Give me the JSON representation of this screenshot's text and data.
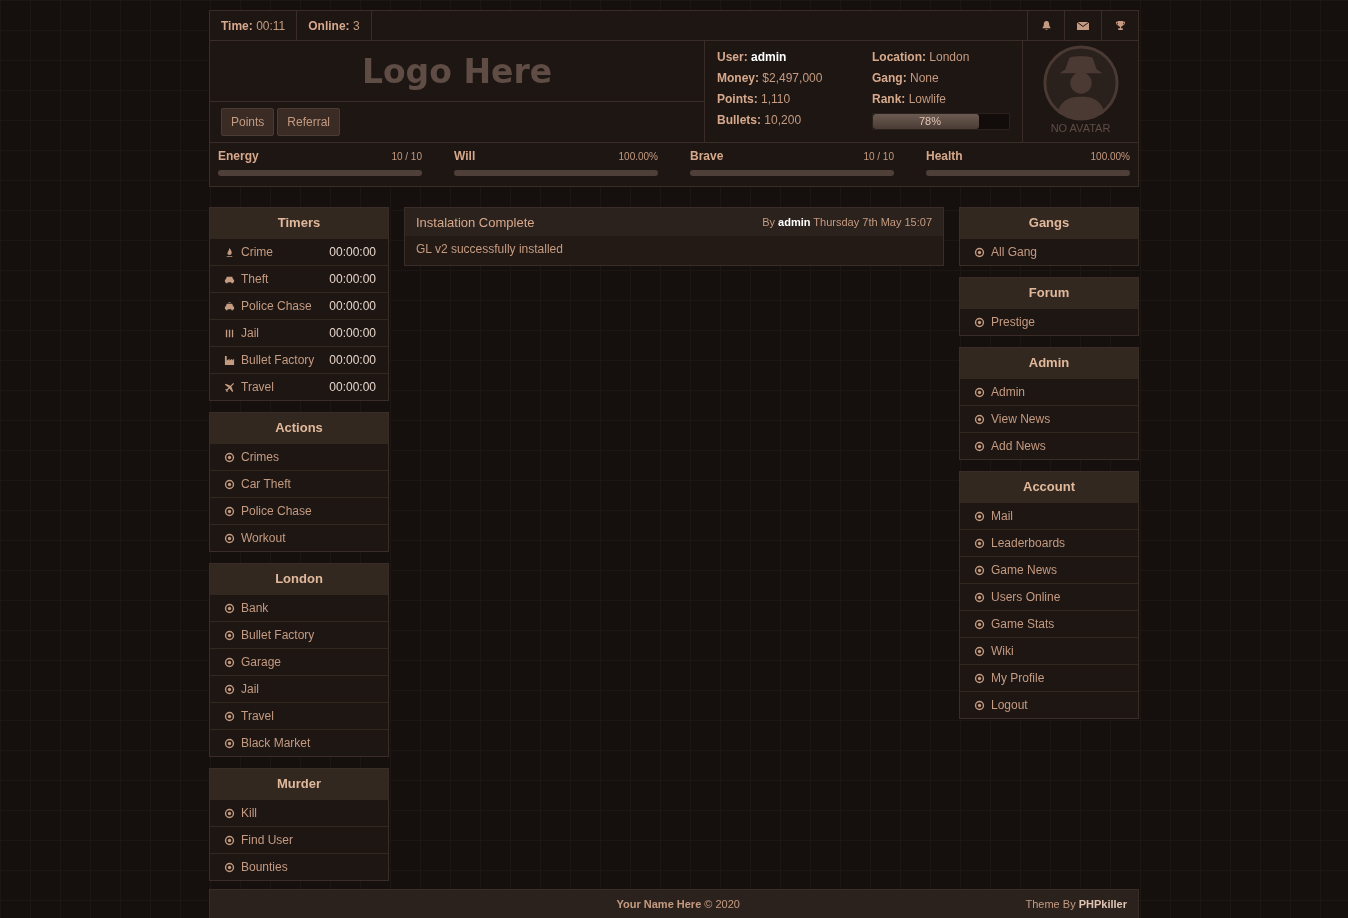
{
  "top_bar": {
    "items": [
      {
        "label": "Time:",
        "value": "00:11"
      },
      {
        "label": "Online:",
        "value": "3"
      }
    ],
    "icons": [
      {
        "kind": "bell"
      },
      {
        "kind": "mail"
      },
      {
        "kind": "trophy"
      }
    ]
  },
  "header": {
    "logo": "Logo Here",
    "buttons": [
      "Points",
      "Referral"
    ],
    "stats": [
      {
        "label": "User:",
        "value": "admin",
        "highlight": true
      },
      {
        "label": "Location:",
        "value": "London",
        "highlight": false
      },
      {
        "label": "Money:",
        "value": "$2,497,000",
        "highlight": false
      },
      {
        "label": "Gang:",
        "value": "None",
        "highlight": false
      },
      {
        "label": "Points:",
        "value": "1,110",
        "highlight": false
      },
      {
        "label": "Rank:",
        "value": "Lowlife",
        "highlight": false
      },
      {
        "label": "Bullets:",
        "value": "10,200",
        "highlight": false
      }
    ],
    "rank_progress": {
      "level": 0.78,
      "reading": "78%"
    },
    "avatar_caption": "NO AVATAR"
  },
  "meters": [
    {
      "label": "Energy",
      "reading": "10 / 10",
      "level": 1
    },
    {
      "label": "Will",
      "reading": "100.00%",
      "level": 1
    },
    {
      "label": "Brave",
      "reading": "10 / 10",
      "level": 1
    },
    {
      "label": "Health",
      "reading": "100.00%",
      "level": 1
    }
  ],
  "left_panels": [
    {
      "title": "Timers",
      "items": [
        {
          "kind": "fire",
          "label": "Crime",
          "time": "00:00:00"
        },
        {
          "kind": "car",
          "label": "Theft",
          "time": "00:00:00"
        },
        {
          "kind": "taxi",
          "label": "Police Chase",
          "time": "00:00:00"
        },
        {
          "kind": "bars",
          "label": "Jail",
          "time": "00:00:00"
        },
        {
          "kind": "factory",
          "label": "Bullet Factory",
          "time": "00:00:00"
        },
        {
          "kind": "plane",
          "label": "Travel",
          "time": "00:00:00"
        }
      ]
    },
    {
      "title": "Actions",
      "items": [
        {
          "kind": "link",
          "label": "Crimes"
        },
        {
          "kind": "link",
          "label": "Car Theft"
        },
        {
          "kind": "link",
          "label": "Police Chase"
        },
        {
          "kind": "link",
          "label": "Workout"
        }
      ]
    },
    {
      "title": "London",
      "items": [
        {
          "kind": "link",
          "label": "Bank"
        },
        {
          "kind": "link",
          "label": "Bullet Factory"
        },
        {
          "kind": "link",
          "label": "Garage"
        },
        {
          "kind": "link",
          "label": "Jail"
        },
        {
          "kind": "link",
          "label": "Travel"
        },
        {
          "kind": "link",
          "label": "Black Market"
        }
      ]
    },
    {
      "title": "Murder",
      "items": [
        {
          "kind": "link",
          "label": "Kill"
        },
        {
          "kind": "link",
          "label": "Find User"
        },
        {
          "kind": "link",
          "label": "Bounties"
        }
      ]
    }
  ],
  "news": {
    "title": "Instalation Complete",
    "by": "By",
    "author": "admin",
    "date": "Thursday 7th May 15:07",
    "body": "GL v2 successfully installed"
  },
  "right_panels": [
    {
      "title": "Gangs",
      "items": [
        {
          "kind": "link",
          "label": "All Gang"
        }
      ]
    },
    {
      "title": "Forum",
      "items": [
        {
          "kind": "link",
          "label": "Prestige"
        }
      ]
    },
    {
      "title": "Admin",
      "items": [
        {
          "kind": "link",
          "label": "Admin"
        },
        {
          "kind": "link",
          "label": "View News"
        },
        {
          "kind": "link",
          "label": "Add News"
        }
      ]
    },
    {
      "title": "Account",
      "items": [
        {
          "kind": "link",
          "label": "Mail"
        },
        {
          "kind": "link",
          "label": "Leaderboards"
        },
        {
          "kind": "link",
          "label": "Game News"
        },
        {
          "kind": "link",
          "label": "Users Online"
        },
        {
          "kind": "link",
          "label": "Game Stats"
        },
        {
          "kind": "link",
          "label": "Wiki"
        },
        {
          "kind": "link",
          "label": "My Profile"
        },
        {
          "kind": "link",
          "label": "Logout"
        }
      ]
    }
  ],
  "footer": {
    "left": "**Your Name Here** © 2020",
    "right": "Theme By **PHPkiller**"
  }
}
